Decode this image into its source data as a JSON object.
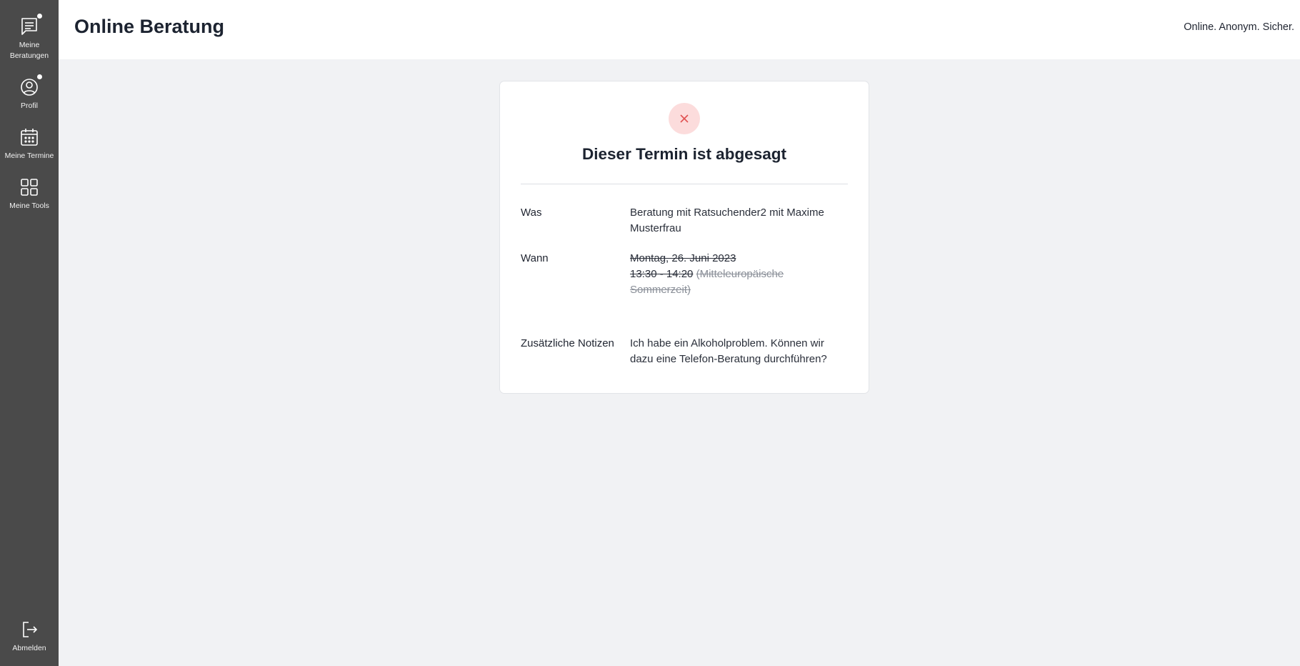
{
  "sidebar": {
    "items": [
      {
        "label_line1": "Meine",
        "label_line2": "Beratungen",
        "icon": "chat-list-icon",
        "badge": true
      },
      {
        "label": "Profil",
        "icon": "user-circle-icon",
        "badge": true
      },
      {
        "label": "Meine Termine",
        "icon": "calendar-icon",
        "badge": false
      },
      {
        "label": "Meine Tools",
        "icon": "grid-icon",
        "badge": false
      }
    ],
    "logout": {
      "label": "Abmelden",
      "icon": "logout-icon"
    }
  },
  "header": {
    "title": "Online Beratung",
    "claim": "Online. Anonym. Sicher."
  },
  "appointment": {
    "status_icon": "close-icon",
    "heading": "Dieser Termin ist abgesagt",
    "what_label": "Was",
    "what_value": "Beratung mit Ratsuchender2 mit Maxime Musterfrau",
    "when_label": "Wann",
    "when_date": "Montag, 26. Juni 2023",
    "when_time": "13:30 - 14:20",
    "when_timezone": "(Mitteleuropäische Sommerzeit)",
    "notes_label": "Zusätzliche Notizen",
    "notes_value": "Ich habe ein Alkoholproblem. Können wir dazu eine Telefon-Beratung durchführen?"
  },
  "colors": {
    "sidebar_bg": "#4a4a4a",
    "page_bg": "#f1f2f4",
    "cancel_bg": "#fcdcdc",
    "cancel_icon": "#e05252"
  }
}
